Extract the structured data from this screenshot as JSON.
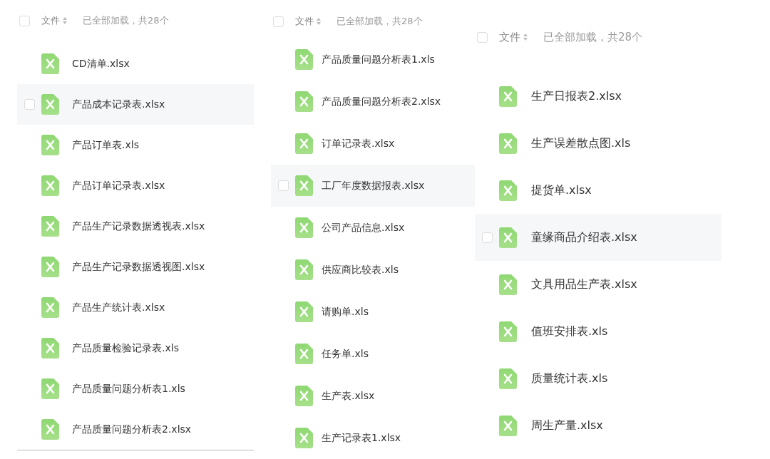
{
  "panels": [
    {
      "header": {
        "column": "文件",
        "status": "已全部加载，共28个",
        "checked": false
      },
      "files": [
        {
          "name": "CD清单.xlsx",
          "hovered": false
        },
        {
          "name": "产品成本记录表.xlsx",
          "hovered": true
        },
        {
          "name": "产品订单表.xls",
          "hovered": false
        },
        {
          "name": "产品订单记录表.xlsx",
          "hovered": false
        },
        {
          "name": "产品生产记录数据透视表.xlsx",
          "hovered": false
        },
        {
          "name": "产品生产记录数据透视图.xlsx",
          "hovered": false
        },
        {
          "name": "产品生产统计表.xlsx",
          "hovered": false
        },
        {
          "name": "产品质量检验记录表.xls",
          "hovered": false
        },
        {
          "name": "产品质量问题分析表1.xls",
          "hovered": false
        },
        {
          "name": "产品质量问题分析表2.xlsx",
          "hovered": false
        }
      ]
    },
    {
      "header": {
        "column": "文件",
        "status": "已全部加载，共28个",
        "checked": false
      },
      "files": [
        {
          "name": "产品质量问题分析表1.xls",
          "hovered": false
        },
        {
          "name": "产品质量问题分析表2.xlsx",
          "hovered": false
        },
        {
          "name": "订单记录表.xlsx",
          "hovered": false
        },
        {
          "name": "工厂年度数据报表.xlsx",
          "hovered": true
        },
        {
          "name": "公司产品信息.xlsx",
          "hovered": false
        },
        {
          "name": "供应商比较表.xls",
          "hovered": false
        },
        {
          "name": "请购单.xls",
          "hovered": false
        },
        {
          "name": "任务单.xls",
          "hovered": false
        },
        {
          "name": "生产表.xlsx",
          "hovered": false
        },
        {
          "name": "生产记录表1.xlsx",
          "hovered": false
        }
      ]
    },
    {
      "header": {
        "column": "文件",
        "status": "已全部加载，共28个",
        "checked": false
      },
      "files": [
        {
          "name": "生产日报表2.xlsx",
          "hovered": false
        },
        {
          "name": "生产误差散点图.xls",
          "hovered": false
        },
        {
          "name": "提货单.xlsx",
          "hovered": false
        },
        {
          "name": "童缘商品介绍表.xlsx",
          "hovered": true
        },
        {
          "name": "文具用品生产表.xlsx",
          "hovered": false
        },
        {
          "name": "值班安排表.xls",
          "hovered": false
        },
        {
          "name": "质量统计表.xls",
          "hovered": false
        },
        {
          "name": "周生产量.xlsx",
          "hovered": false
        }
      ]
    }
  ]
}
